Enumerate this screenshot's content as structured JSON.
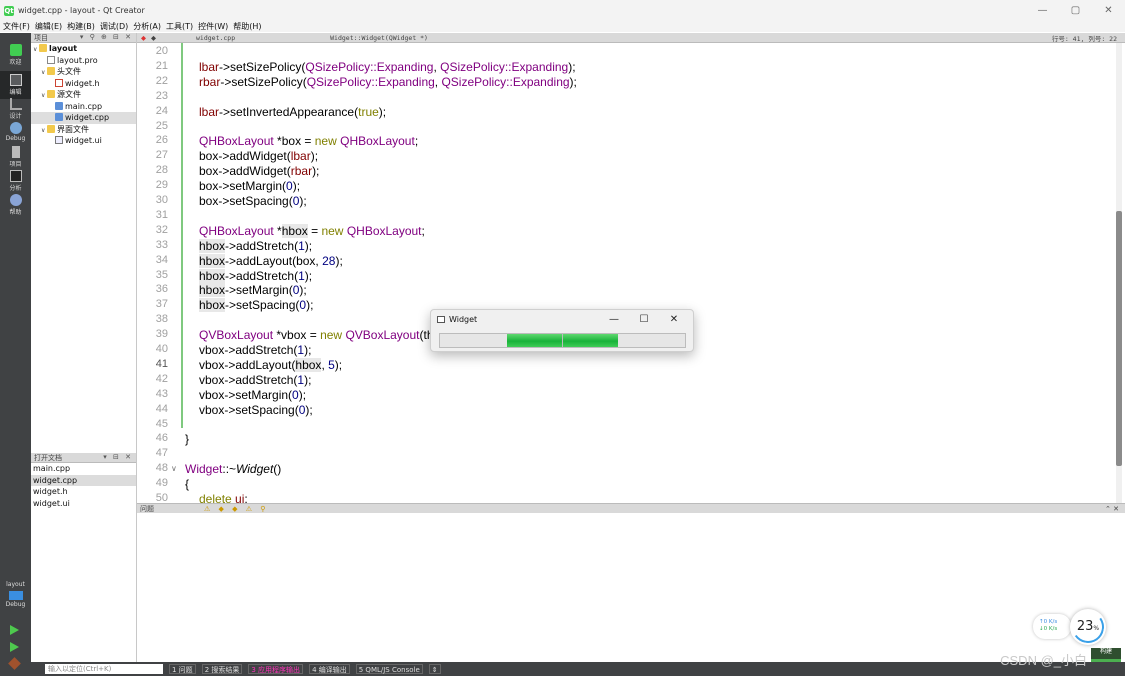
{
  "window": {
    "title": "widget.cpp - layout - Qt Creator",
    "app_icon": "Qt",
    "minimize": "—",
    "maximize": "▢",
    "close": "✕"
  },
  "menu": [
    "文件(F)",
    "编辑(E)",
    "构建(B)",
    "调试(D)",
    "分析(A)",
    "工具(T)",
    "控件(W)",
    "帮助(H)"
  ],
  "modes": [
    {
      "label": "欢迎",
      "icon": "qt-logo-icon"
    },
    {
      "label": "编辑",
      "icon": "edit-icon"
    },
    {
      "label": "设计",
      "icon": "design-icon"
    },
    {
      "label": "Debug",
      "icon": "debug-icon"
    },
    {
      "label": "项目",
      "icon": "project-icon"
    },
    {
      "label": "分析",
      "icon": "analyze-icon"
    },
    {
      "label": "帮助",
      "icon": "help-icon"
    }
  ],
  "kit": {
    "project": "layout",
    "config": "Debug"
  },
  "project_panel": {
    "header": "项目",
    "tools": "▾ ⚲ ⊕ ⊟ ✕",
    "tree": [
      {
        "label": "layout",
        "depth": 0,
        "icon": "folder",
        "chev": "∨",
        "bold": true
      },
      {
        "label": "layout.pro",
        "depth": 1,
        "icon": "pro",
        "chev": ""
      },
      {
        "label": "头文件",
        "depth": 1,
        "icon": "folder",
        "chev": "∨"
      },
      {
        "label": "widget.h",
        "depth": 2,
        "icon": "h",
        "chev": ""
      },
      {
        "label": "源文件",
        "depth": 1,
        "icon": "folder",
        "chev": "∨"
      },
      {
        "label": "main.cpp",
        "depth": 2,
        "icon": "cpp",
        "chev": ""
      },
      {
        "label": "widget.cpp",
        "depth": 2,
        "icon": "cpp",
        "chev": "",
        "selected": true
      },
      {
        "label": "界面文件",
        "depth": 1,
        "icon": "folder",
        "chev": "∨"
      },
      {
        "label": "widget.ui",
        "depth": 2,
        "icon": "ui",
        "chev": ""
      }
    ]
  },
  "open_docs": {
    "header": "打开文档",
    "tools": "▾ ⊟ ✕",
    "items": [
      {
        "label": "main.cpp"
      },
      {
        "label": "widget.cpp",
        "selected": true
      },
      {
        "label": "widget.h"
      },
      {
        "label": "widget.ui"
      }
    ]
  },
  "editor_toolbar": {
    "file": "widget.cpp",
    "symbol": "Widget::Widget(QWidget *)",
    "position": "行号: 41, 列号: 22"
  },
  "code": [
    {
      "n": "20",
      "segs": []
    },
    {
      "n": "21",
      "segs": [
        [
          "mem",
          "lbar"
        ],
        [
          "",
          "->setSizePolicy("
        ],
        [
          "ty",
          "QSizePolicy::Expanding"
        ],
        [
          "",
          ", "
        ],
        [
          "ty",
          "QSizePolicy::Expanding"
        ],
        [
          "",
          ");"
        ]
      ]
    },
    {
      "n": "22",
      "segs": [
        [
          "mem",
          "rbar"
        ],
        [
          "",
          "->setSizePolicy("
        ],
        [
          "ty",
          "QSizePolicy::Expanding"
        ],
        [
          "",
          ", "
        ],
        [
          "ty",
          "QSizePolicy::Expanding"
        ],
        [
          "",
          ");"
        ]
      ]
    },
    {
      "n": "23",
      "segs": []
    },
    {
      "n": "24",
      "segs": [
        [
          "mem",
          "lbar"
        ],
        [
          "",
          "->setInvertedAppearance("
        ],
        [
          "kw",
          "true"
        ],
        [
          "",
          ");"
        ]
      ]
    },
    {
      "n": "25",
      "segs": []
    },
    {
      "n": "26",
      "segs": [
        [
          "ty",
          "QHBoxLayout"
        ],
        [
          "",
          " *box = "
        ],
        [
          "kw",
          "new"
        ],
        [
          "",
          " "
        ],
        [
          "ty",
          "QHBoxLayout"
        ],
        [
          "",
          ";"
        ]
      ]
    },
    {
      "n": "27",
      "segs": [
        [
          "",
          "box->addWidget("
        ],
        [
          "mem",
          "lbar"
        ],
        [
          "",
          ");"
        ]
      ]
    },
    {
      "n": "28",
      "segs": [
        [
          "",
          "box->addWidget("
        ],
        [
          "mem",
          "rbar"
        ],
        [
          "",
          ");"
        ]
      ]
    },
    {
      "n": "29",
      "segs": [
        [
          "",
          "box->setMargin("
        ],
        [
          "num",
          "0"
        ],
        [
          "",
          ");"
        ]
      ]
    },
    {
      "n": "30",
      "segs": [
        [
          "",
          "box->setSpacing("
        ],
        [
          "num",
          "0"
        ],
        [
          "",
          ");"
        ]
      ]
    },
    {
      "n": "31",
      "segs": []
    },
    {
      "n": "32",
      "segs": [
        [
          "ty",
          "QHBoxLayout"
        ],
        [
          "",
          " *"
        ],
        [
          "hl",
          "hbox"
        ],
        [
          "",
          " = "
        ],
        [
          "kw",
          "new"
        ],
        [
          "",
          " "
        ],
        [
          "ty",
          "QHBoxLayout"
        ],
        [
          "",
          ";"
        ]
      ]
    },
    {
      "n": "33",
      "segs": [
        [
          "hl",
          "hbox"
        ],
        [
          "",
          "->addStretch("
        ],
        [
          "num",
          "1"
        ],
        [
          "",
          ");"
        ]
      ]
    },
    {
      "n": "34",
      "segs": [
        [
          "hl",
          "hbox"
        ],
        [
          "",
          "->addLayout(box, "
        ],
        [
          "num",
          "28"
        ],
        [
          "",
          ");"
        ]
      ]
    },
    {
      "n": "35",
      "segs": [
        [
          "hl",
          "hbox"
        ],
        [
          "",
          "->addStretch("
        ],
        [
          "num",
          "1"
        ],
        [
          "",
          ");"
        ]
      ]
    },
    {
      "n": "36",
      "segs": [
        [
          "hl",
          "hbox"
        ],
        [
          "",
          "->setMargin("
        ],
        [
          "num",
          "0"
        ],
        [
          "",
          ");"
        ]
      ]
    },
    {
      "n": "37",
      "segs": [
        [
          "hl",
          "hbox"
        ],
        [
          "",
          "->setSpacing("
        ],
        [
          "num",
          "0"
        ],
        [
          "",
          ");"
        ]
      ]
    },
    {
      "n": "38",
      "segs": []
    },
    {
      "n": "39",
      "segs": [
        [
          "ty",
          "QVBoxLayout"
        ],
        [
          "",
          " *vbox = "
        ],
        [
          "kw",
          "new"
        ],
        [
          "",
          " "
        ],
        [
          "ty",
          "QVBoxLayout"
        ],
        [
          "",
          "(th"
        ]
      ]
    },
    {
      "n": "40",
      "segs": [
        [
          "",
          "vbox->addStretch("
        ],
        [
          "num",
          "1"
        ],
        [
          "",
          ");"
        ]
      ]
    },
    {
      "n": "41",
      "segs": [
        [
          "",
          "vbox->addLayout("
        ],
        [
          "hl",
          "hbox"
        ],
        [
          "",
          ", "
        ],
        [
          "num",
          "5"
        ],
        [
          "",
          ");"
        ]
      ],
      "current": true
    },
    {
      "n": "42",
      "segs": [
        [
          "",
          "vbox->addStretch("
        ],
        [
          "num",
          "1"
        ],
        [
          "",
          ");"
        ]
      ]
    },
    {
      "n": "43",
      "segs": [
        [
          "",
          "vbox->setMargin("
        ],
        [
          "num",
          "0"
        ],
        [
          "",
          ");"
        ]
      ]
    },
    {
      "n": "44",
      "segs": [
        [
          "",
          "vbox->setSpacing("
        ],
        [
          "num",
          "0"
        ],
        [
          "",
          ");"
        ]
      ]
    },
    {
      "n": "45",
      "segs": []
    },
    {
      "n": "46",
      "segs": [
        [
          "",
          "}"
        ]
      ],
      "outdent": true
    },
    {
      "n": "47",
      "segs": []
    },
    {
      "n": "48",
      "segs": [
        [
          "ty",
          "Widget"
        ],
        [
          "",
          "::~"
        ],
        [
          "it",
          "Widget"
        ],
        [
          "",
          "()"
        ]
      ],
      "outdent": true,
      "fold": "∨"
    },
    {
      "n": "49",
      "segs": [
        [
          "",
          "{"
        ]
      ],
      "outdent": true
    },
    {
      "n": "50",
      "segs": [
        [
          "kw",
          "delete"
        ],
        [
          "",
          " "
        ],
        [
          "mem",
          "ui"
        ],
        [
          "",
          ";"
        ]
      ]
    }
  ],
  "issues_panel": {
    "title": "问题",
    "tools": "⚠ ◆ ◆ ⚠ ⚲",
    "close": "⌃ ✕"
  },
  "statusbar": {
    "locator_placeholder": "输入以定位(Ctrl+K)",
    "tabs": [
      "1 问题",
      "2 搜索结果",
      "3 应用程序输出",
      "4 编译输出",
      "5 QML/JS Console",
      "⇕"
    ]
  },
  "speed": {
    "up": "↑0 K/s",
    "down": "↓0 K/s"
  },
  "cpu": {
    "value": "23",
    "unit": "%"
  },
  "build_button": "构建",
  "watermark": "CSDN @_小白",
  "widget_window": {
    "title": "Widget",
    "minimize": "—",
    "maximize": "☐",
    "close": "✕",
    "left_bar": {
      "inverted": true,
      "fill_fraction": 0.45
    },
    "right_bar": {
      "inverted": false,
      "fill_fraction": 0.45
    }
  },
  "colors": {
    "keyword": "#808000",
    "type": "#800080",
    "member": "#800000",
    "number": "#000080",
    "progress_green": "#19b33a",
    "modebar": "#404244"
  }
}
